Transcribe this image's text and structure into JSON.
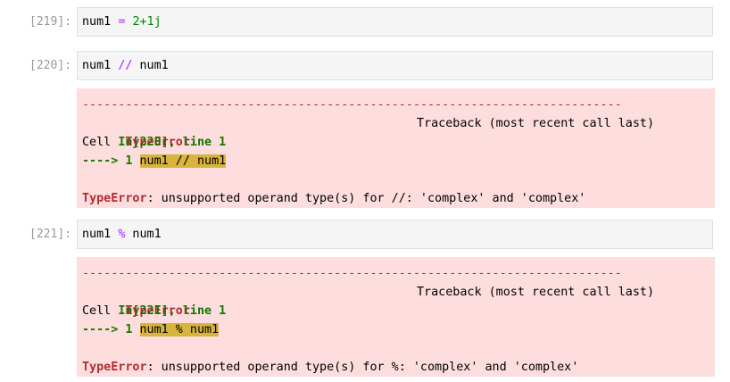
{
  "cells": [
    {
      "prompt": "[219]:",
      "code": {
        "a": "num1 ",
        "op": "=",
        "b": " ",
        "num": "2+1j"
      }
    },
    {
      "prompt": "[220]:",
      "code": {
        "a": "num1 ",
        "op": "//",
        "b": " num1"
      },
      "error": {
        "dashes": "---------------------------------------------------------------------------",
        "type": "TypeError",
        "traceback_label": "Traceback (most recent call last)",
        "cell_prefix": "Cell ",
        "cell_ref": "In[220], line 1",
        "arrow": "----> 1 ",
        "arrow_code": "num1 // num1",
        "message_type": "TypeError",
        "message": ": unsupported operand type(s) for //: 'complex' and 'complex'"
      }
    },
    {
      "prompt": "[221]:",
      "code": {
        "a": "num1 ",
        "op": "%",
        "b": " num1"
      },
      "error": {
        "dashes": "---------------------------------------------------------------------------",
        "type": "TypeError",
        "traceback_label": "Traceback (most recent call last)",
        "cell_prefix": "Cell ",
        "cell_ref": "In[221], line 1",
        "arrow": "----> 1 ",
        "arrow_code": "num1 % num1",
        "message_type": "TypeError",
        "message": ": unsupported operand type(s) for %: 'complex' and 'complex'"
      }
    }
  ],
  "colors": {
    "error_bg": "#fddddd",
    "error_red": "#b22b31",
    "highlight": "#d7b43c",
    "input_bg": "#f5f5f5",
    "prompt_gray": "#999999"
  }
}
